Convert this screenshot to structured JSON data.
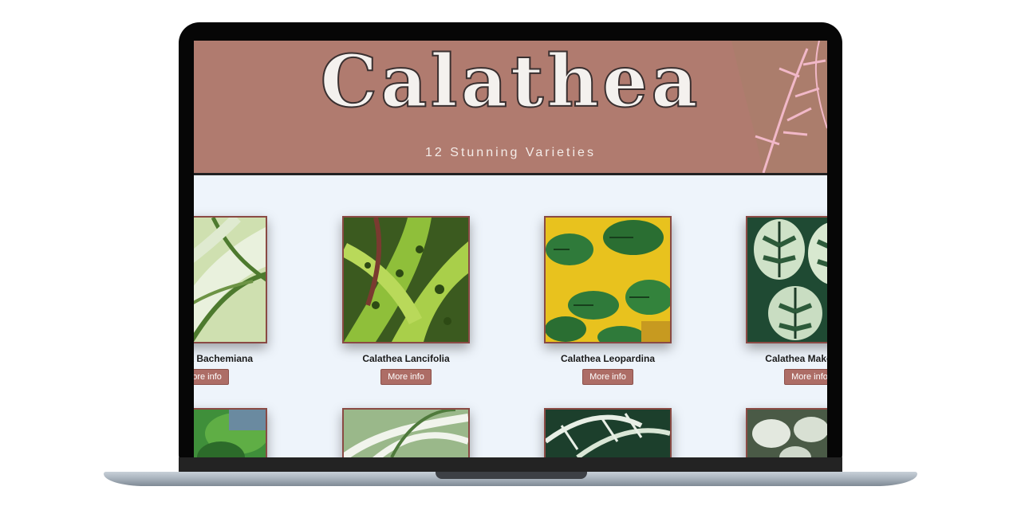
{
  "banner": {
    "title": "Calathea",
    "subtitle": "12 Stunning Varieties"
  },
  "plants": [
    {
      "name": "Calathea Bachemiana",
      "button_label": "More info"
    },
    {
      "name": "Calathea Lancifolia",
      "button_label": "More info"
    },
    {
      "name": "Calathea Leopardina",
      "button_label": "More info"
    },
    {
      "name": "Calathea Makoyana",
      "button_label": "More info"
    }
  ],
  "colors": {
    "banner": "#b07b6f",
    "page_background": "#eef4fb",
    "button": "#ad6d66",
    "card_border": "#8a4a44"
  }
}
